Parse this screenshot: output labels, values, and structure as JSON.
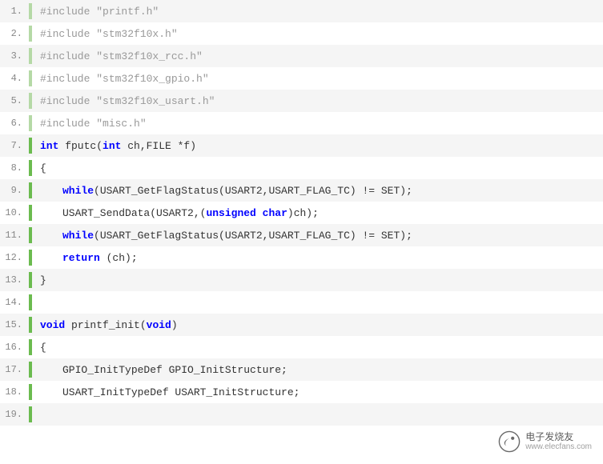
{
  "code": {
    "lines": [
      {
        "n": "1.",
        "dim": true,
        "tokens": [
          {
            "t": "#include "
          },
          {
            "t": "\"printf.h\""
          }
        ]
      },
      {
        "n": "2.",
        "dim": true,
        "tokens": [
          {
            "t": "#include "
          },
          {
            "t": "\"stm32f10x.h\""
          }
        ]
      },
      {
        "n": "3.",
        "dim": true,
        "tokens": [
          {
            "t": "#include "
          },
          {
            "t": "\"stm32f10x_rcc.h\""
          }
        ]
      },
      {
        "n": "4.",
        "dim": true,
        "tokens": [
          {
            "t": "#include "
          },
          {
            "t": "\"stm32f10x_gpio.h\""
          }
        ]
      },
      {
        "n": "5.",
        "dim": true,
        "tokens": [
          {
            "t": "#include "
          },
          {
            "t": "\"stm32f10x_usart.h\""
          }
        ]
      },
      {
        "n": "6.",
        "dim": true,
        "tokens": [
          {
            "t": "#include "
          },
          {
            "t": "\"misc.h\""
          }
        ]
      },
      {
        "n": "7.",
        "dim": false,
        "tokens": [
          {
            "t": "int",
            "c": "kw"
          },
          {
            "t": " fputc("
          },
          {
            "t": "int",
            "c": "kw"
          },
          {
            "t": " ch,FILE *f)"
          }
        ]
      },
      {
        "n": "8.",
        "dim": false,
        "tokens": [
          {
            "t": "{"
          }
        ]
      },
      {
        "n": "9.",
        "dim": false,
        "indent": 1,
        "tokens": [
          {
            "t": "while",
            "c": "kw"
          },
          {
            "t": "(USART_GetFlagStatus(USART2,USART_FLAG_TC) != SET);"
          }
        ]
      },
      {
        "n": "10.",
        "dim": false,
        "indent": 1,
        "tokens": [
          {
            "t": "USART_SendData(USART2,("
          },
          {
            "t": "unsigned",
            "c": "kw"
          },
          {
            "t": " "
          },
          {
            "t": "char",
            "c": "kw"
          },
          {
            "t": ")ch);"
          }
        ]
      },
      {
        "n": "11.",
        "dim": false,
        "indent": 1,
        "tokens": [
          {
            "t": "while",
            "c": "kw"
          },
          {
            "t": "(USART_GetFlagStatus(USART2,USART_FLAG_TC) != SET);"
          }
        ]
      },
      {
        "n": "12.",
        "dim": false,
        "indent": 1,
        "tokens": [
          {
            "t": "return",
            "c": "kw"
          },
          {
            "t": " (ch);"
          }
        ]
      },
      {
        "n": "13.",
        "dim": false,
        "tokens": [
          {
            "t": "}"
          }
        ]
      },
      {
        "n": "14.",
        "dim": false,
        "tokens": [
          {
            "t": " "
          }
        ]
      },
      {
        "n": "15.",
        "dim": false,
        "tokens": [
          {
            "t": "void",
            "c": "kw"
          },
          {
            "t": " printf_init("
          },
          {
            "t": "void",
            "c": "kw"
          },
          {
            "t": ")"
          }
        ]
      },
      {
        "n": "16.",
        "dim": false,
        "tokens": [
          {
            "t": "{"
          }
        ]
      },
      {
        "n": "17.",
        "dim": false,
        "indent": 1,
        "tokens": [
          {
            "t": "GPIO_InitTypeDef GPIO_InitStructure;"
          }
        ]
      },
      {
        "n": "18.",
        "dim": false,
        "indent": 1,
        "tokens": [
          {
            "t": "USART_InitTypeDef USART_InitStructure;"
          }
        ]
      },
      {
        "n": "19.",
        "dim": false,
        "tokens": [
          {
            "t": " "
          }
        ]
      }
    ]
  },
  "watermark": {
    "title": "电子发烧友",
    "url": "www.elecfans.com"
  }
}
